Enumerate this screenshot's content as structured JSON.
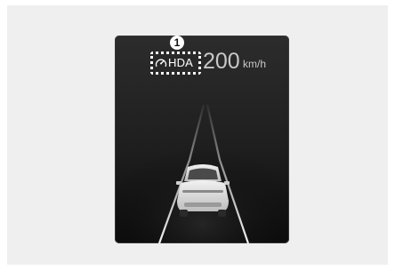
{
  "callout": {
    "number": "1"
  },
  "hud": {
    "icon": "speedometer-icon",
    "label": "HDA",
    "speed_value": "200",
    "speed_unit": "km/h"
  },
  "colors": {
    "panel_background": "#efefef",
    "display_background": "#1e1e1e",
    "highlight": "#ffffff",
    "speed_text": "#c8c8c8"
  }
}
